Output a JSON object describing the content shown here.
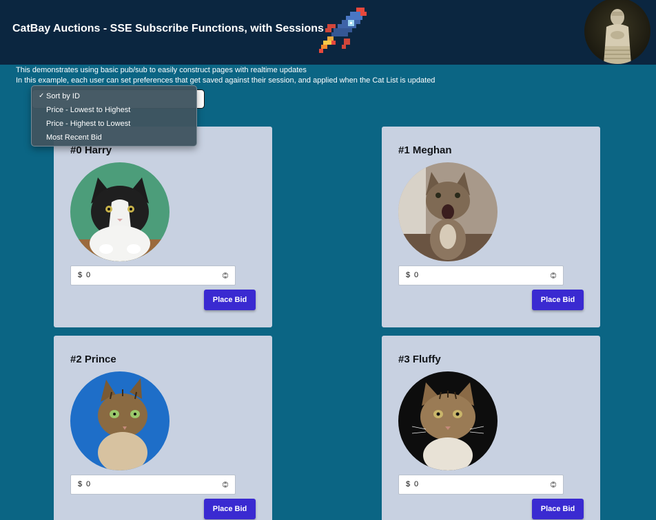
{
  "app": {
    "title": "CatBay Auctions - SSE Subscribe Functions, with Sessions",
    "logo_icon": "rocket-icon",
    "avatar_icon": "statue-avatar"
  },
  "intro": {
    "line1": "This demonstrates using basic pub/sub to easily construct pages with realtime updates",
    "line2": "In this example, each user can set preferences that get saved against their session, and applied when the Cat List is updated"
  },
  "sort": {
    "selected": "Sort by ID",
    "options": [
      {
        "label": "Sort by ID",
        "checked": "✓"
      },
      {
        "label": "Price - Lowest to Highest",
        "checked": ""
      },
      {
        "label": "Price - Highest to Lowest",
        "checked": ""
      },
      {
        "label": "Most Recent Bid",
        "checked": ""
      }
    ]
  },
  "cats": [
    {
      "name": "#0 Harry",
      "currency": "$",
      "bid": "0",
      "button": "Place Bid",
      "photo_bg": "#4c9d7a"
    },
    {
      "name": "#1 Meghan",
      "currency": "$",
      "bid": "0",
      "button": "Place Bid",
      "photo_bg": "#8a7a66"
    },
    {
      "name": "#2 Prince",
      "currency": "$",
      "bid": "0",
      "button": "Place Bid",
      "photo_bg": "#1e6ec8"
    },
    {
      "name": "#3 Fluffy",
      "currency": "$",
      "bid": "0",
      "button": "Place Bid",
      "photo_bg": "#0d0d0d"
    }
  ],
  "colors": {
    "page_bg": "#0b6584",
    "header_bg": "#0b2640",
    "card_bg": "#c8d1e1",
    "button_bg": "#3a2ad1"
  }
}
